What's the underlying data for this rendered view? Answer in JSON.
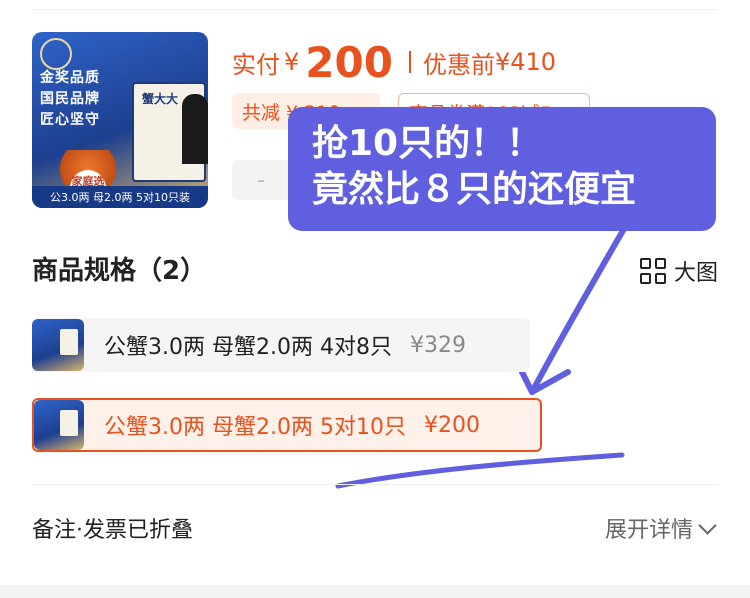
{
  "product": {
    "thumbnail": {
      "tagline": [
        "金奖品质",
        "国民品牌",
        "匠心坚守"
      ],
      "box_title": "蟹大大",
      "badge": "家庭选鲜",
      "spec_strip": "公3.0两 母2.0两 5对10只装"
    },
    "price": {
      "paid_label": "实付",
      "currency": "¥",
      "paid_value": "200",
      "original_label": "优惠前",
      "original_value": "¥410"
    },
    "discount_chips": [
      "共减 ¥ 210",
      "商品券满183减5"
    ],
    "stepper_minus": "-"
  },
  "annotation": {
    "line1": "抢10只的！！",
    "line2": "竟然比８只的还便宜",
    "color": "#5f5fe0"
  },
  "specs": {
    "title": "商品规格（2）",
    "big_image_label": "大图",
    "options": [
      {
        "text": "公蟹3.0两 母蟹2.0两 4对8只",
        "price": "¥329",
        "selected": false
      },
      {
        "text": "公蟹3.0两 母蟹2.0两 5对10只",
        "price": "¥200",
        "selected": true
      }
    ]
  },
  "remark": {
    "label": "备注·发票已折叠",
    "expand_label": "展开详情"
  },
  "colors": {
    "accent": "#e8521f",
    "overlay": "#5f5fe0"
  }
}
